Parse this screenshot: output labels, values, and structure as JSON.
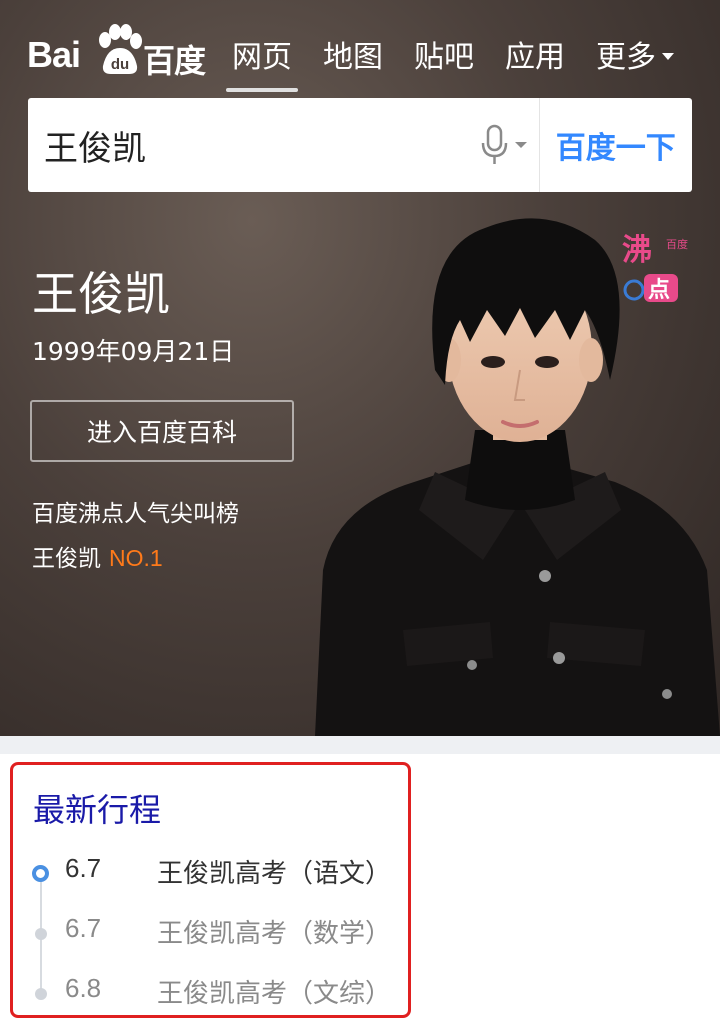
{
  "header": {
    "logo_text_en": "Bai",
    "logo_paw_text": "du",
    "logo_text_cn": "百度",
    "nav": [
      {
        "label": "网页",
        "active": true
      },
      {
        "label": "地图",
        "active": false
      },
      {
        "label": "贴吧",
        "active": false
      },
      {
        "label": "应用",
        "active": false
      },
      {
        "label": "更多",
        "active": false
      }
    ]
  },
  "search": {
    "query": "王俊凯",
    "button_label": "百度一下"
  },
  "person": {
    "name": "王俊凯",
    "birth": "1999年09月21日",
    "baike_button": "进入百度百科",
    "rank_title": "百度沸点人气尖叫榜",
    "rank_name": "王俊凯",
    "rank_no": "NO.1"
  },
  "badge": {
    "main": "沸",
    "sub": "百度",
    "dot": "点"
  },
  "schedule": {
    "title": "最新行程",
    "items": [
      {
        "date": "6.7",
        "event": "王俊凯高考（语文）",
        "current": true
      },
      {
        "date": "6.7",
        "event": "王俊凯高考（数学）",
        "current": false
      },
      {
        "date": "6.8",
        "event": "王俊凯高考（文综）",
        "current": false
      }
    ]
  },
  "colors": {
    "accent": "#3388ff",
    "rank_no": "#ff7a1a",
    "schedule_title": "#1a1aa8",
    "highlight_border": "#e02020",
    "timeline_active": "#4a90e2"
  }
}
